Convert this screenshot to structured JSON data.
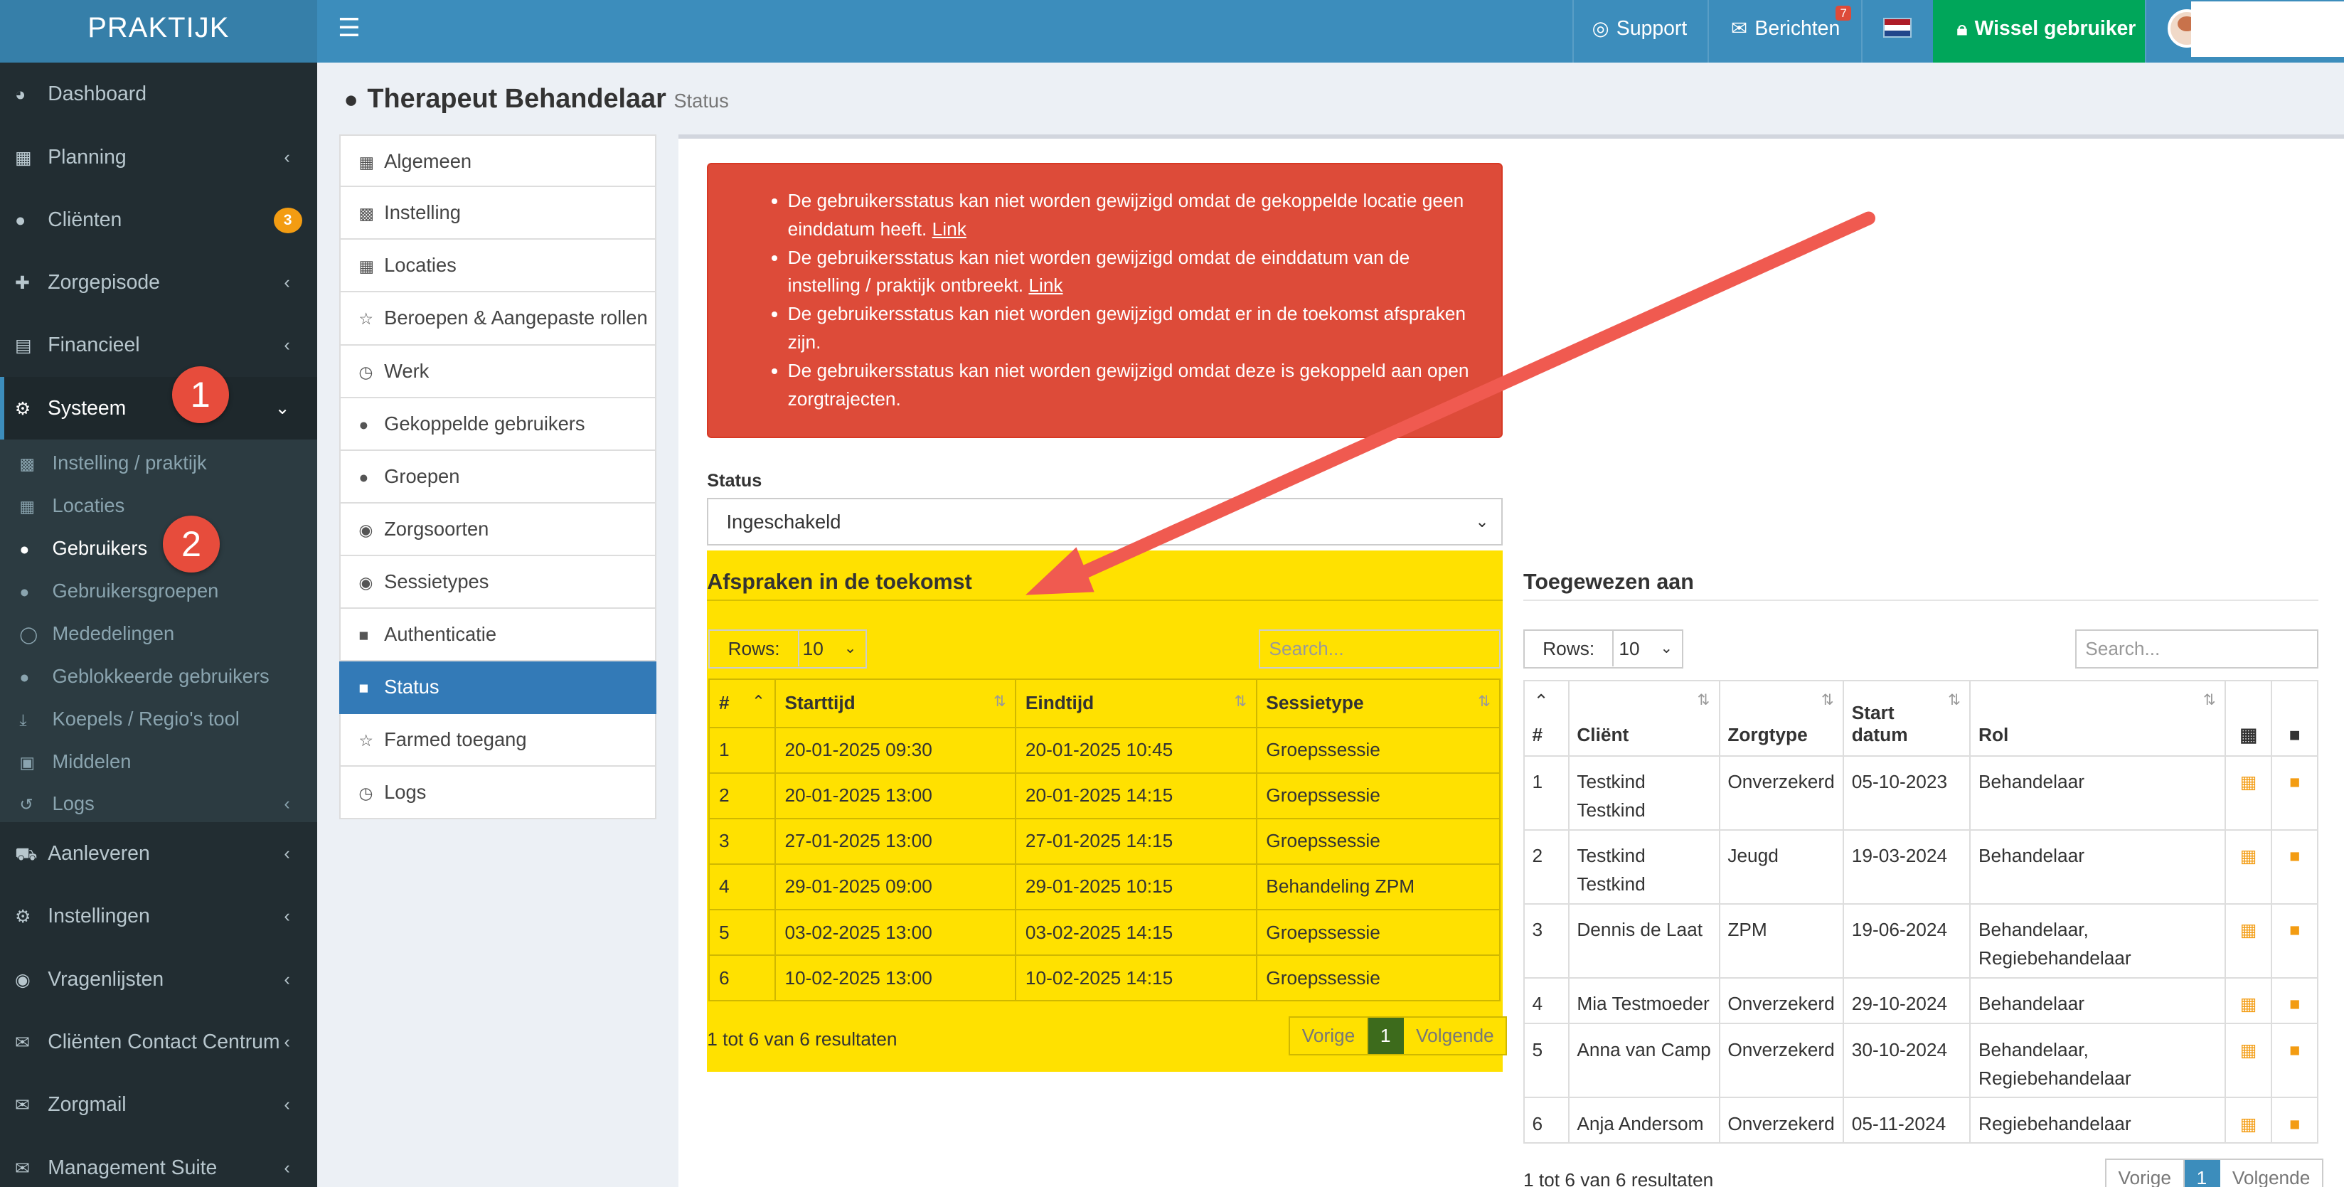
{
  "topbar": {
    "logo": "PRAKTIJK",
    "support": "Support",
    "berichten": "Berichten",
    "berichten_badge": "7",
    "wissel": "Wissel gebruiker"
  },
  "sidebar": {
    "items": [
      {
        "label": "Dashboard"
      },
      {
        "label": "Planning"
      },
      {
        "label": "Cliënten",
        "badge": "3"
      },
      {
        "label": "Zorgepisode"
      },
      {
        "label": "Financieel"
      },
      {
        "label": "Systeem"
      }
    ],
    "sub": [
      {
        "label": "Instelling / praktijk"
      },
      {
        "label": "Locaties"
      },
      {
        "label": "Gebruikers"
      },
      {
        "label": "Gebruikersgroepen"
      },
      {
        "label": "Mededelingen"
      },
      {
        "label": "Geblokkeerde gebruikers"
      },
      {
        "label": "Koepels / Regio's tool"
      },
      {
        "label": "Middelen"
      },
      {
        "label": "Logs"
      }
    ],
    "items2": [
      {
        "label": "Aanleveren"
      },
      {
        "label": "Instellingen"
      },
      {
        "label": "Vragenlijsten"
      },
      {
        "label": "Cliënten Contact Centrum"
      },
      {
        "label": "Zorgmail"
      },
      {
        "label": "Management Suite"
      }
    ]
  },
  "markers": [
    "1",
    "2",
    "3"
  ],
  "page": {
    "title": "Therapeut Behandelaar",
    "subtitle": "Status"
  },
  "menu": [
    {
      "label": "Algemeen"
    },
    {
      "label": "Instelling"
    },
    {
      "label": "Locaties"
    },
    {
      "label": "Beroepen & Aangepaste rollen"
    },
    {
      "label": "Werk"
    },
    {
      "label": "Gekoppelde gebruikers"
    },
    {
      "label": "Groepen"
    },
    {
      "label": "Zorgsoorten"
    },
    {
      "label": "Sessietypes"
    },
    {
      "label": "Authenticatie"
    },
    {
      "label": "Status"
    },
    {
      "label": "Farmed toegang"
    },
    {
      "label": "Logs"
    }
  ],
  "alert": {
    "items": [
      {
        "text": "De gebruikersstatus kan niet worden gewijzigd omdat de gekoppelde locatie geen einddatum heeft.",
        "link": "Link"
      },
      {
        "text": "De gebruikersstatus kan niet worden gewijzigd omdat de einddatum van de instelling / praktijk ontbreekt.",
        "link": "Link"
      },
      {
        "text": "De gebruikersstatus kan niet worden gewijzigd omdat er in de toekomst afspraken zijn.",
        "link": ""
      },
      {
        "text": "De gebruikersstatus kan niet worden gewijzigd omdat deze is gekoppeld aan open zorgtrajecten.",
        "link": ""
      }
    ]
  },
  "status": {
    "label": "Status",
    "value": "Ingeschakeld"
  },
  "afspraken": {
    "title": "Afspraken in de toekomst",
    "rows_label": "Rows:",
    "rows_value": "10",
    "search_placeholder": "Search...",
    "headers": [
      "#",
      "Starttijd",
      "Eindtijd",
      "Sessietype"
    ],
    "rows": [
      [
        "1",
        "20-01-2025 09:30",
        "20-01-2025 10:45",
        "Groepssessie"
      ],
      [
        "2",
        "20-01-2025 13:00",
        "20-01-2025 14:15",
        "Groepssessie"
      ],
      [
        "3",
        "27-01-2025 13:00",
        "27-01-2025 14:15",
        "Groepssessie"
      ],
      [
        "4",
        "29-01-2025 09:00",
        "29-01-2025 10:15",
        "Behandeling ZPM"
      ],
      [
        "5",
        "03-02-2025 13:00",
        "03-02-2025 14:15",
        "Groepssessie"
      ],
      [
        "6",
        "10-02-2025 13:00",
        "10-02-2025 14:15",
        "Groepssessie"
      ]
    ],
    "info": "1 tot 6 van 6 resultaten",
    "prev": "Vorige",
    "page": "1",
    "next": "Volgende"
  },
  "toegewezen": {
    "title": "Toegewezen aan",
    "rows_label": "Rows:",
    "rows_value": "10",
    "search_placeholder": "Search...",
    "headers": [
      "#",
      "Cliënt",
      "Zorgtype",
      "Start datum",
      "Rol"
    ],
    "rows": [
      [
        "1",
        "Testkind Testkind",
        "Onverzekerd",
        "05-10-2023",
        "Behandelaar"
      ],
      [
        "2",
        "Testkind Testkind",
        "Jeugd",
        "19-03-2024",
        "Behandelaar"
      ],
      [
        "3",
        "Dennis de Laat",
        "ZPM",
        "19-06-2024",
        "Behandelaar, Regiebehandelaar"
      ],
      [
        "4",
        "Mia Testmoeder",
        "Onverzekerd",
        "29-10-2024",
        "Behandelaar"
      ],
      [
        "5",
        "Anna van Camp",
        "Onverzekerd",
        "30-10-2024",
        "Behandelaar, Regiebehandelaar"
      ],
      [
        "6",
        "Anja Andersom",
        "Onverzekerd",
        "05-11-2024",
        "Regiebehandelaar"
      ]
    ],
    "info": "1 tot 6 van 6 resultaten",
    "prev": "Vorige",
    "page": "1",
    "next": "Volgende"
  },
  "colors": {
    "topbar": "#3c8dbc",
    "sidebar": "#222d32",
    "alert": "#dd4b39",
    "highlight": "#ffe100",
    "wissel": "#00a65a",
    "page_active": "#3c8dbc",
    "page_active_left": "#3d6b1c"
  }
}
